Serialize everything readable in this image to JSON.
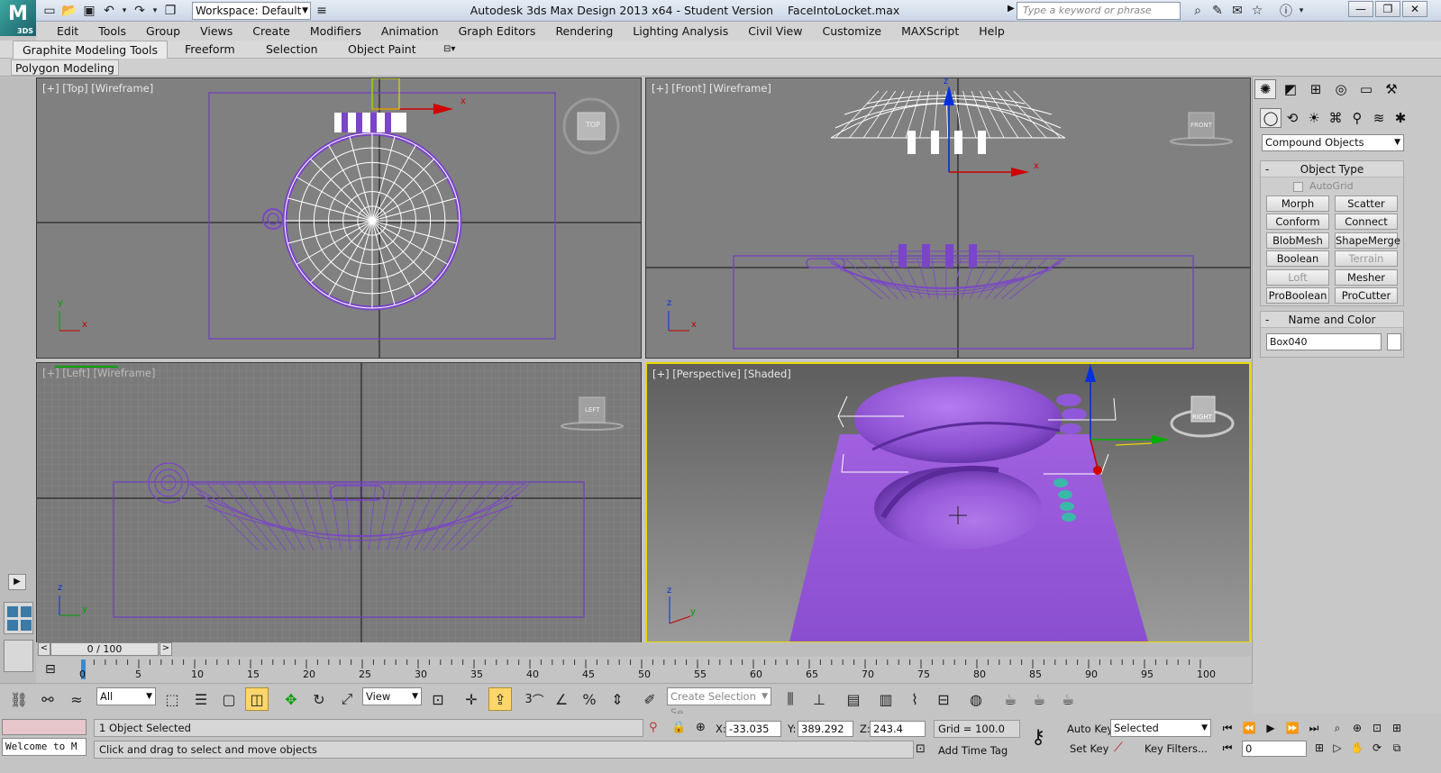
{
  "app": {
    "title": "Autodesk 3ds Max Design 2013 x64 - Student Version",
    "file": "FaceIntoLocket.max",
    "logo_text": "3DS",
    "search_placeholder": "Type a keyword or phrase",
    "workspace": "Workspace: Default"
  },
  "menu": [
    "Edit",
    "Tools",
    "Group",
    "Views",
    "Create",
    "Modifiers",
    "Animation",
    "Graph Editors",
    "Rendering",
    "Lighting Analysis",
    "Civil View",
    "Customize",
    "MAXScript",
    "Help"
  ],
  "ribbon": {
    "tabs": [
      "Graphite Modeling Tools",
      "Freeform",
      "Selection",
      "Object Paint"
    ],
    "active_tab": "Graphite Modeling Tools",
    "panel": "Polygon Modeling"
  },
  "viewports": {
    "top": "[+] [Top] [Wireframe]",
    "front": "[+] [Front] [Wireframe]",
    "left": "[+] [Left] [Wireframe]",
    "perspective": "[+] [Perspective] [Shaded]",
    "cube_top": "TOP",
    "cube_front": "FRONT",
    "cube_left": "LEFT",
    "cube_right": "RIGHT",
    "axis_x": "x",
    "axis_y": "y",
    "axis_z": "z"
  },
  "command_panel": {
    "category": "Compound Objects",
    "object_type_title": "Object Type",
    "autogrid": "AutoGrid",
    "buttons": [
      {
        "label": "Morph",
        "enabled": true
      },
      {
        "label": "Scatter",
        "enabled": true
      },
      {
        "label": "Conform",
        "enabled": true
      },
      {
        "label": "Connect",
        "enabled": true
      },
      {
        "label": "BlobMesh",
        "enabled": true
      },
      {
        "label": "ShapeMerge",
        "enabled": true
      },
      {
        "label": "Boolean",
        "enabled": true
      },
      {
        "label": "Terrain",
        "enabled": false
      },
      {
        "label": "Loft",
        "enabled": false
      },
      {
        "label": "Mesher",
        "enabled": true
      },
      {
        "label": "ProBoolean",
        "enabled": true
      },
      {
        "label": "ProCutter",
        "enabled": true
      }
    ],
    "name_color_title": "Name and Color",
    "object_name": "Box040",
    "rollout_minus": "-"
  },
  "timeline": {
    "frame": "0 / 100",
    "ticks": [
      "0",
      "5",
      "10",
      "15",
      "20",
      "25",
      "30",
      "35",
      "40",
      "45",
      "50",
      "55",
      "60",
      "65",
      "70",
      "75",
      "80",
      "85",
      "90",
      "95",
      "100"
    ],
    "prev": "<",
    "next": ">"
  },
  "toolbar": {
    "selection_filter": "All",
    "ref_coord": "View",
    "snap_label": "3",
    "create_selection_set": "Create Selection Se"
  },
  "status": {
    "welcome": "Welcome to M",
    "selected": "1 Object Selected",
    "prompt": "Click and drag to select and move objects",
    "x_label": "X:",
    "x": "-33.035",
    "y_label": "Y:",
    "y": "389.292",
    "z_label": "Z:",
    "z": "243.4",
    "grid": "Grid = 100.0",
    "add_time_tag": "Add Time Tag",
    "auto_key": "Auto Key",
    "set_key": "Set Key",
    "key_mode": "Selected",
    "key_filters": "Key Filters...",
    "current_frame": "0"
  },
  "colors": {
    "object_purple": "#8a4fd0",
    "wire_white": "#ffffff",
    "active_border": "#e8d800",
    "axis_red": "#d00000",
    "axis_green": "#00a000",
    "axis_blue": "#0030e0"
  }
}
